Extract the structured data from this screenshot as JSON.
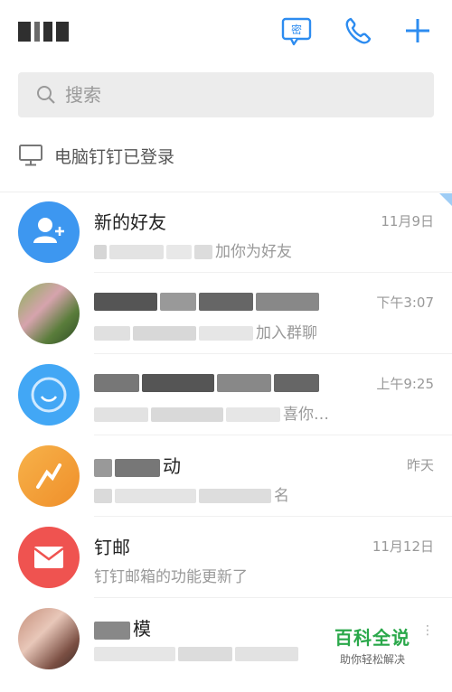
{
  "header": {
    "title_obscured": true,
    "secret_chat_icon": "secret-chat-icon",
    "secret_chat_char": "密",
    "phone_icon": "phone-icon",
    "add_icon": "plus-icon",
    "accent": "#2d8cf0"
  },
  "search": {
    "placeholder": "搜索",
    "icon": "search-icon"
  },
  "pc_login": {
    "icon": "monitor-icon",
    "text": "电脑钉钉已登录"
  },
  "conversations": [
    {
      "name": "新的好友",
      "time": "11月9日",
      "preview_tail": "加你为好友",
      "avatar": "add-friend-avatar",
      "avatar_color": "#3d97f0"
    },
    {
      "name": "",
      "time": "下午3:07",
      "preview_tail": "加入群聊",
      "avatar": "group-photo-avatar"
    },
    {
      "name": "",
      "time": "上午9:25",
      "preview_tail": "喜你…",
      "avatar": "blue-avatar",
      "avatar_color": "#42a7f5"
    },
    {
      "name_tail": "动",
      "time": "昨天",
      "preview_tail": "名",
      "avatar": "orange-avatar",
      "avatar_color": "#f5a33a"
    },
    {
      "name": "钉邮",
      "time": "11月12日",
      "preview": "钉钉邮箱的功能更新了",
      "avatar": "mail-avatar",
      "avatar_color": "#ef5350"
    },
    {
      "name_tail": "模",
      "time": "",
      "preview_tail": "",
      "avatar": "photo-avatar"
    }
  ],
  "watermark": {
    "title": "百科全说",
    "subtitle": "助你轻松解决"
  }
}
